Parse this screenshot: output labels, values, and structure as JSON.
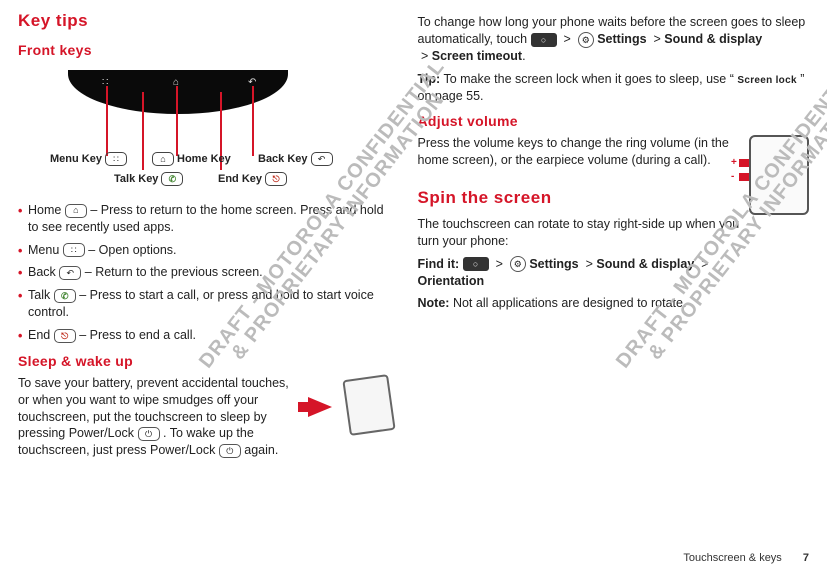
{
  "left": {
    "section_title": "Key tips",
    "front_keys_heading": "Front keys",
    "diagram": {
      "menu_key": "Menu Key",
      "home_key": "Home Key",
      "back_key": "Back Key",
      "talk_key": "Talk Key",
      "end_key": "End Key"
    },
    "keys": [
      {
        "label": "Home",
        "icon": "⌂",
        "desc_after": " – Press to return to the home screen. Press and hold to see recently used apps."
      },
      {
        "label": "Menu",
        "icon": "∷",
        "desc_after": " – Open options."
      },
      {
        "label": "Back",
        "icon": "↶",
        "desc_after": " – Return to the previous screen."
      },
      {
        "label": "Talk",
        "icon": "✆",
        "desc_after": " – Press to start a call, or press and hold to start voice control."
      },
      {
        "label": "End",
        "icon": "⎋",
        "desc_after": " – Press to end a call."
      }
    ],
    "sleep_heading": "Sleep & wake up",
    "sleep_body_a": "To save your battery, prevent accidental touches, or when you want to wipe smudges off your touchscreen, put the touchscreen to sleep by pressing Power/Lock ",
    "sleep_body_b": ". To wake up the touchscreen, just press Power/Lock ",
    "sleep_body_c": " again.",
    "power_icon": "⏻"
  },
  "right": {
    "timeout_a": "To change how long your phone waits before the screen goes to sleep automatically, touch ",
    "timeout_path": " >  Settings > Sound & display > Screen timeout",
    "timeout_b": ".",
    "tip_label": "Tip:",
    "tip_text_a": " To make the screen lock when it goes to sleep, use “",
    "tip_screen_lock": "Screen lock",
    "tip_text_b": "” on page 55.",
    "adjust_heading": "Adjust volume",
    "adjust_text": "Press the volume keys to change the ring volume (in the home screen), or the earpiece volume (during a call).",
    "spin_heading": "Spin the screen",
    "spin_text": "The touchscreen can rotate to stay right-side up when you turn your phone:",
    "find_it_label": "Find it:",
    "find_it_path": " >  Settings > Sound & display > Orientation",
    "note_label": "Note:",
    "note_text": " Not all applications are designed to rotate."
  },
  "footer": {
    "section": "Touchscreen & keys",
    "page": "7"
  },
  "watermark": "DRAFT - MOTOROLA CONFIDENTIAL\n& PROPRIETARY INFORMATION"
}
